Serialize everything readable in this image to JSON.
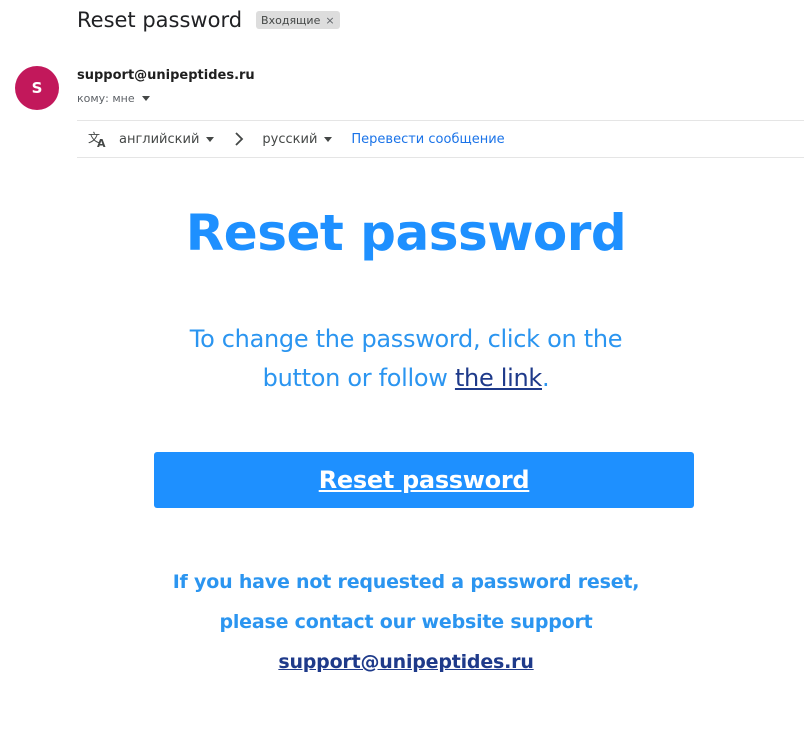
{
  "header": {
    "subject": "Reset password",
    "label": "Входящие",
    "label_close": "×"
  },
  "sender": {
    "avatar_letter": "S",
    "email": "support@unipeptides.ru",
    "recipient": "кому: мне"
  },
  "translate": {
    "icon": "translate-icon",
    "from_lang": "английский",
    "to_lang": "русский",
    "action": "Перевести сообщение"
  },
  "email": {
    "title": "Reset password",
    "intro_before": "To change the password, click on the button or follow ",
    "intro_link": "the link",
    "intro_after": ".",
    "button_label": "Reset password",
    "note_line1": "If you have not requested a password reset,",
    "note_line2": "please contact our website support",
    "support_link": "support@unipeptides.ru"
  },
  "colors": {
    "accent": "#1e90ff",
    "link_dark": "#1e3a8a",
    "avatar": "#c2185b",
    "gmail_link": "#1a73e8"
  }
}
